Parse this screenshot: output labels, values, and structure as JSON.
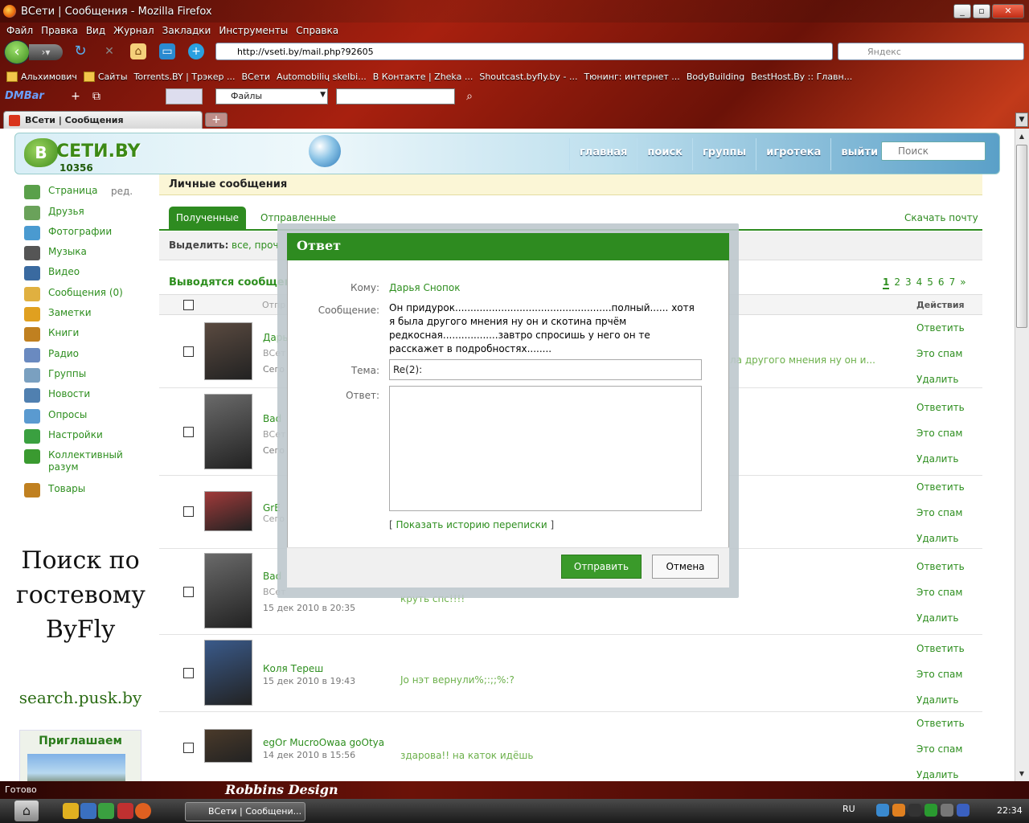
{
  "window": {
    "title": "ВСети | Сообщения - Mozilla Firefox"
  },
  "menu": [
    "Файл",
    "Правка",
    "Вид",
    "Журнал",
    "Закладки",
    "Инструменты",
    "Справка"
  ],
  "urlbar": {
    "url": "http://vseti.by/mail.php?92605"
  },
  "browser_search": {
    "placeholder": "Яндекс"
  },
  "bookmarks": [
    "Альхимович",
    "Сайты",
    "Torrents.BY | Трэкер ...",
    "ВСети",
    "Automobilių skelbi...",
    "В Контакте | Zheka ...",
    "Shoutcast.byfly.by - ...",
    "Тюнинг: интернет ...",
    "BodyBuilding",
    "BestHost.By :: Главн..."
  ],
  "dmbar": {
    "label": "DMBar",
    "files": "Файлы"
  },
  "tab": {
    "title": "ВСети | Сообщения"
  },
  "site": {
    "logo": "СЕТИ.BY",
    "logo_letter": "В",
    "counter": "10356",
    "nav": [
      "главная",
      "поиск",
      "группы",
      "игротека",
      "выйти"
    ],
    "search_placeholder": "Поиск"
  },
  "sidebar": {
    "edit": "ред.",
    "items": [
      {
        "label": "Страница",
        "icon": "home-icon",
        "color": "#5aa04a"
      },
      {
        "label": "Друзья",
        "icon": "friends-icon",
        "color": "#6aa25a"
      },
      {
        "label": "Фотографии",
        "icon": "photo-icon",
        "color": "#4a9ad0"
      },
      {
        "label": "Музыка",
        "icon": "headphones-icon",
        "color": "#555555"
      },
      {
        "label": "Видео",
        "icon": "film-icon",
        "color": "#3a6aa0"
      },
      {
        "label": "Сообщения (0)",
        "icon": "mail-icon",
        "color": "#e0b040"
      },
      {
        "label": "Заметки",
        "icon": "pencil-icon",
        "color": "#e0a020"
      },
      {
        "label": "Книги",
        "icon": "book-icon",
        "color": "#c08020"
      },
      {
        "label": "Радио",
        "icon": "radio-icon",
        "color": "#6a8ac0"
      },
      {
        "label": "Группы",
        "icon": "groups-icon",
        "color": "#7aa0c0"
      },
      {
        "label": "Новости",
        "icon": "news-icon",
        "color": "#5080b0"
      },
      {
        "label": "Опросы",
        "icon": "poll-icon",
        "color": "#5a9ad0"
      },
      {
        "label": "Настройки",
        "icon": "settings-icon",
        "color": "#3aa040"
      },
      {
        "label": "Коллективный разум",
        "icon": "question-icon",
        "color": "#3a9a30"
      },
      {
        "label": "Товары",
        "icon": "goods-icon",
        "color": "#c08020"
      }
    ]
  },
  "ad": {
    "line1": "Поиск по гостевому ByFly",
    "line2": "search.pusk.by",
    "invite": "Приглашаем"
  },
  "main": {
    "title": "Личные сообщения",
    "tab_in": "Полученные",
    "tab_out": "Отправленные",
    "download": "Скачать почту",
    "select_label": "Выделить:",
    "select_values": "все, проч",
    "showing": "Выводятся сообщени",
    "pager": [
      "1",
      "2",
      "3",
      "4",
      "5",
      "6",
      "7",
      "»"
    ],
    "col_sender": "Отпр",
    "col_actions": "Действия",
    "actions": {
      "reply": "Ответить",
      "spam": "Это спам",
      "delete": "Удалить"
    }
  },
  "messages": [
    {
      "sender": "Дарь",
      "sub": "ВСет",
      "date": "Сего",
      "text": "ла другого мнения ну он и...",
      "avatar": "#5a4a40"
    },
    {
      "sender": "Bad",
      "sub": "ВСет",
      "date": "Сего",
      "text": "",
      "avatar": "#6a6a6a"
    },
    {
      "sender": "GrE",
      "sub": "Сего",
      "date": "",
      "text": "",
      "avatar": "#a03a3a"
    },
    {
      "sender": "Bad",
      "sub": "ВСет",
      "date": "15 дек 2010 в 20:35",
      "text": "круть спс!!!!",
      "avatar": "#6a6a6a"
    },
    {
      "sender": "Коля Тереш",
      "sub": "",
      "date": "15 дек 2010 в 19:43",
      "text": "Jo нэт вернули%;:;;%:?",
      "avatar": "#3a5a8a"
    },
    {
      "sender": "egOr MucroOwaa goOtya",
      "sub": "",
      "date": "14 дек 2010 в 15:56",
      "text": "здарова!! на каток идёшь",
      "avatar": "#4a3a2a"
    }
  ],
  "dialog": {
    "title": "Ответ",
    "to_label": "Кому:",
    "to": "Дарья Снопок",
    "msg_label": "Сообщение:",
    "message": "Он придурок...................................................полный......\nхотя я была другого мнения ну он и скотина прчём редкосная..................завтро спросишь у него он те расскажет в подробностях........",
    "subject_label": "Тема:",
    "subject": "Re(2):",
    "answer_label": "Ответ:",
    "history": "Показать историю переписки",
    "send": "Отправить",
    "cancel": "Отмена"
  },
  "status": {
    "text": "Готово",
    "design": "Robbins Design"
  },
  "taskbar": {
    "item": "ВСети | Сообщени...",
    "lang": "RU",
    "time": "22:34"
  }
}
